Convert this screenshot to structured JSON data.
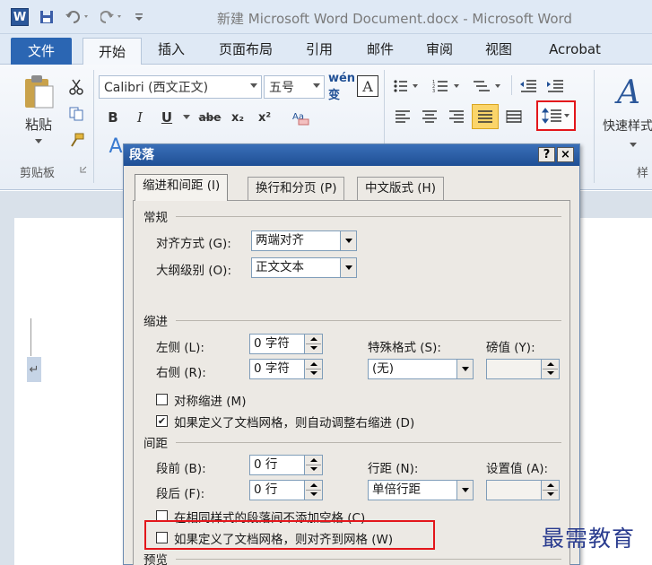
{
  "window": {
    "title": "新建 Microsoft Word Document.docx - Microsoft Word",
    "app_icon_letter": "W"
  },
  "tabs": [
    {
      "label": "文件"
    },
    {
      "label": "开始"
    },
    {
      "label": "插入"
    },
    {
      "label": "页面布局"
    },
    {
      "label": "引用"
    },
    {
      "label": "邮件"
    },
    {
      "label": "审阅"
    },
    {
      "label": "视图"
    },
    {
      "label": "Acrobat"
    }
  ],
  "ribbon": {
    "paste_label": "粘贴",
    "clipboard_group_label": "剪贴板",
    "font_name": "Calibri (西文正文)",
    "font_size": "五号",
    "wen_glyph": "wén 变",
    "format_a": "A",
    "bold": "B",
    "italic": "I",
    "underline": "U",
    "strikethrough": "abe",
    "subscript": "x₂",
    "superscript": "x²",
    "quick_styles_label": "快速样式",
    "styles_group_label": "样",
    "accent_color": "#2b579a"
  },
  "dialog": {
    "title": "段落",
    "help_button": "?",
    "close_button": "×",
    "tabs": [
      "缩进和间距 (I)",
      "换行和分页 (P)",
      "中文版式 (H)"
    ],
    "general": {
      "section": "常规",
      "alignment_label": "对齐方式 (G):",
      "alignment_value": "两端对齐",
      "outline_label": "大纲级别 (O):",
      "outline_value": "正文文本"
    },
    "indent": {
      "section": "缩进",
      "left_label": "左侧 (L):",
      "left_value": "0 字符",
      "right_label": "右侧 (R):",
      "right_value": "0 字符",
      "special_label": "特殊格式 (S):",
      "special_value": "(无)",
      "by_label": "磅值 (Y):",
      "by_value": "",
      "mirror_label": "对称缩进 (M)",
      "mirror_checked": false,
      "auto_adjust_label": "如果定义了文档网格，则自动调整右缩进 (D)",
      "auto_adjust_checked": true
    },
    "spacing": {
      "section": "间距",
      "before_label": "段前 (B):",
      "before_value": "0 行",
      "after_label": "段后 (F):",
      "after_value": "0 行",
      "line_spacing_label": "行距 (N):",
      "line_spacing_value": "单倍行距",
      "at_label": "设置值 (A):",
      "at_value": "",
      "no_space_label": "在相同样式的段落间不添加空格 (C)",
      "no_space_checked": false,
      "snap_grid_label": "如果定义了文档网格，则对齐到网格 (W)",
      "snap_grid_checked": false
    },
    "preview_section": "预览"
  },
  "watermark": "最需教育",
  "colors": {
    "highlight_red": "#e3161b",
    "file_tab_blue": "#2b66b3",
    "dialog_title_blue": "#1f4f95"
  }
}
